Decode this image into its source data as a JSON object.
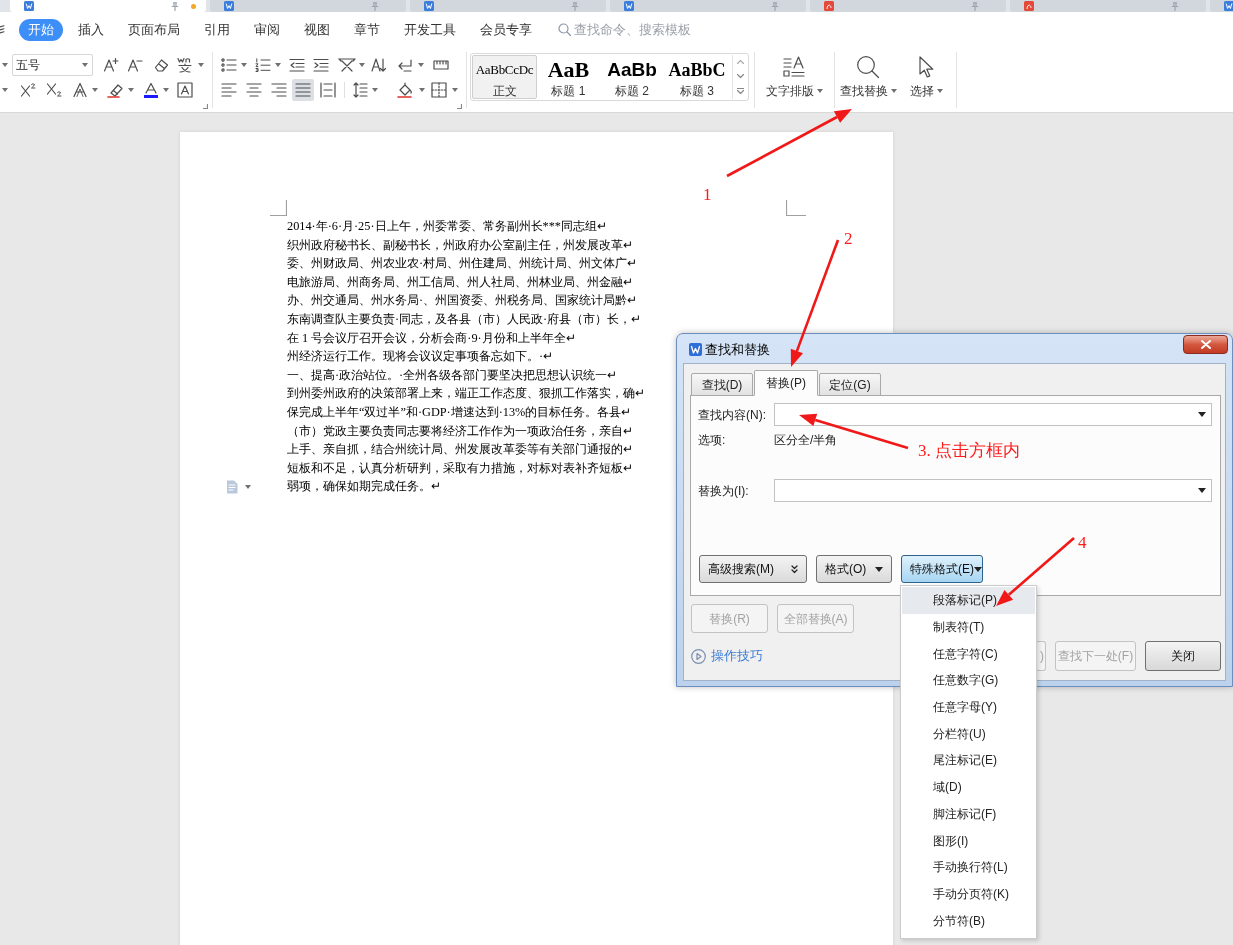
{
  "doc_tabs": [
    {
      "kind": "word",
      "selected": true,
      "modified": true
    },
    {
      "kind": "word",
      "selected": false,
      "modified": false
    },
    {
      "kind": "word",
      "selected": false,
      "modified": false
    },
    {
      "kind": "word",
      "selected": false,
      "modified": false
    },
    {
      "kind": "pdf",
      "selected": false,
      "modified": false
    },
    {
      "kind": "pdf",
      "selected": false,
      "modified": false
    },
    {
      "kind": "word",
      "selected": false,
      "modified": false
    }
  ],
  "menu_tabs": [
    {
      "label": "开始",
      "selected": true
    },
    {
      "label": "插入",
      "selected": false
    },
    {
      "label": "页面布局",
      "selected": false
    },
    {
      "label": "引用",
      "selected": false
    },
    {
      "label": "审阅",
      "selected": false
    },
    {
      "label": "视图",
      "selected": false
    },
    {
      "label": "章节",
      "selected": false
    },
    {
      "label": "开发工具",
      "selected": false
    },
    {
      "label": "会员专享",
      "selected": false
    }
  ],
  "command_search": {
    "placeholder": "查找命令、搜索模板"
  },
  "toolbar": {
    "font_size": "五号",
    "align_buttons": [
      {
        "kind": "left",
        "selected": false
      },
      {
        "kind": "center",
        "selected": false
      },
      {
        "kind": "right",
        "selected": false
      },
      {
        "kind": "justify",
        "selected": true
      },
      {
        "kind": "distributed",
        "selected": false
      }
    ]
  },
  "styles": [
    {
      "kind": "body",
      "preview": "AaBbCcDc",
      "label": "正文",
      "selected": true
    },
    {
      "kind": "heading1",
      "preview": "AaB",
      "label": "标题 1",
      "selected": false
    },
    {
      "kind": "heading2",
      "preview": "AaBb",
      "label": "标题 2",
      "selected": false
    },
    {
      "kind": "heading3",
      "preview": "AaBbC",
      "label": "标题 3",
      "selected": false
    }
  ],
  "tool_buttons": [
    {
      "kind": "typeset",
      "label": "文字排版"
    },
    {
      "kind": "find",
      "label": "查找替换"
    },
    {
      "kind": "select",
      "label": "选择"
    }
  ],
  "document": {
    "paragraphs": [
      "2014·年·6·月·25·日上午，州委常委、常务副州长***同志组↵",
      "织州政府秘书长、副秘书长，州政府办公室副主任，州发展改革↵",
      "委、州财政局、州农业农·村局、州住建局、州统计局、州文体广↵",
      "电旅游局、州商务局、州工信局、州人社局、州林业局、州金融↵",
      "办、州交通局、州水务局·、州国资委、州税务局、国家统计局黔↵",
      "东南调查队主要负责·同志，及各县（市）人民政·府县（市）长，↵",
      "在 1 号会议厅召开会议，分析会商·9·月份和上半年全↵",
      "州经济运行工作。现将会议议定事项备忘如下。·↵",
      "一、提高·政治站位。·全州各级各部门要坚决把思想认识统一↵",
      "到州委州政府的决策部署上来，端正工作态度、狠抓工作落实，确↵",
      "保完成上半年“双过半”和·GDP·增速达到·13%的目标任务。各县↵",
      "（市）党政主要负责同志要将经济工作作为一项政治任务，亲自↵",
      "上手、亲自抓，结合州统计局、州发展改革委等有关部门通报的↵",
      "短板和不足，认真分析研判，采取有力措施，对标对表补齐短板↵",
      "弱项，确保如期完成任务。↵"
    ]
  },
  "dialog": {
    "title": "查找和替换",
    "tabs": [
      {
        "label": "查找(D)",
        "selected": false
      },
      {
        "label": "替换(P)",
        "selected": true
      },
      {
        "label": "定位(G)",
        "selected": false
      }
    ],
    "find_field": {
      "label": "查找内容(N):"
    },
    "options": {
      "label": "选项:",
      "value": "区分全/半角"
    },
    "replace_field": {
      "label": "替换为(I):"
    },
    "option_buttons": [
      {
        "kind": "expand",
        "label": "高级搜索(M)",
        "pressed": false
      },
      {
        "kind": "dropdown",
        "label": "格式(O)",
        "pressed": false
      },
      {
        "kind": "dropdown",
        "label": "特殊格式(E)",
        "pressed": true
      }
    ],
    "action_buttons": [
      {
        "label": "替换(R)",
        "disabled": true
      },
      {
        "label": "全部替换(A)",
        "disabled": true
      }
    ],
    "tips_link": "操作技巧",
    "nav_buttons": [
      {
        "kind": "clipped",
        "label": ")",
        "disabled": true
      },
      {
        "kind": "normal",
        "label": "查找下一处(F)",
        "disabled": true
      },
      {
        "kind": "normal",
        "label": "关闭",
        "disabled": false
      }
    ]
  },
  "special_menu": {
    "items": [
      {
        "label": "段落标记(P)",
        "selected": true
      },
      {
        "label": "制表符(T)",
        "selected": false
      },
      {
        "label": "任意字符(C)",
        "selected": false
      },
      {
        "label": "任意数字(G)",
        "selected": false
      },
      {
        "label": "任意字母(Y)",
        "selected": false
      },
      {
        "label": "分栏符(U)",
        "selected": false
      },
      {
        "label": "尾注标记(E)",
        "selected": false
      },
      {
        "label": "域(D)",
        "selected": false
      },
      {
        "label": "脚注标记(F)",
        "selected": false
      },
      {
        "label": "图形(I)",
        "selected": false
      },
      {
        "label": "手动换行符(L)",
        "selected": false
      },
      {
        "label": "手动分页符(K)",
        "selected": false
      },
      {
        "label": "分节符(B)",
        "selected": false
      }
    ]
  },
  "annotations": [
    {
      "label": "1"
    },
    {
      "label": "2"
    },
    {
      "label": "3. 点击方框内"
    },
    {
      "label": "4"
    }
  ]
}
